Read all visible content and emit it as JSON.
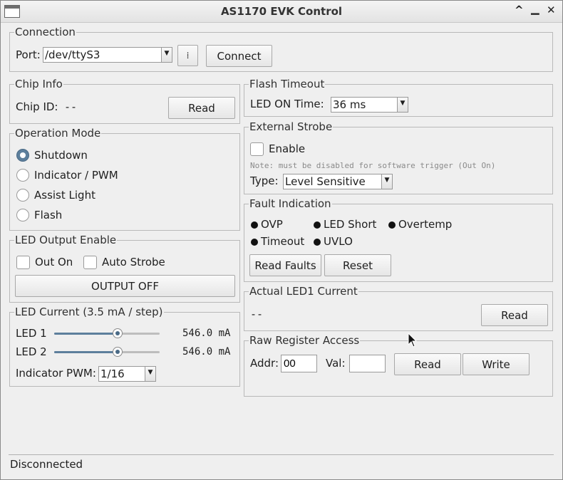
{
  "window": {
    "title": "AS1170 EVK Control"
  },
  "titlebar": {
    "minimize": "▁",
    "maximize": "^",
    "close": "✕"
  },
  "connection": {
    "legend": "Connection",
    "port_label": "Port:",
    "port_value": "/dev/ttyS3",
    "connect_label": "Connect"
  },
  "chip_info": {
    "legend": "Chip Info",
    "chip_id_label": "Chip ID:",
    "chip_id_value": "--",
    "read_label": "Read"
  },
  "operation_mode": {
    "legend": "Operation Mode",
    "options": [
      "Shutdown",
      "Indicator / PWM",
      "Assist Light",
      "Flash"
    ],
    "selected": "Shutdown"
  },
  "led_output": {
    "legend": "LED Output Enable",
    "out_on_label": "Out On",
    "auto_strobe_label": "Auto Strobe",
    "output_button": "OUTPUT OFF"
  },
  "led_current": {
    "legend": "LED Current (3.5 mA / step)",
    "led1_label": "LED 1",
    "led1_value": "546.0 mA",
    "led1_level": 0.6,
    "led2_label": "LED 2",
    "led2_value": "546.0 mA",
    "led2_level": 0.6,
    "pwm_label": "Indicator PWM:",
    "pwm_value": "1/16"
  },
  "flash_timeout": {
    "legend": "Flash Timeout",
    "led_on_label": "LED ON Time:",
    "led_on_value": "36 ms"
  },
  "external_strobe": {
    "legend": "External Strobe",
    "enable_label": "Enable",
    "note": "Note: must be disabled for software trigger (Out On)",
    "type_label": "Type:",
    "type_value": "Level Sensitive"
  },
  "fault_indication": {
    "legend": "Fault Indication",
    "faults": [
      "OVP",
      "LED Short",
      "Overtemp",
      "Timeout",
      "UVLO"
    ],
    "read_faults_label": "Read Faults",
    "reset_label": "Reset"
  },
  "actual_current": {
    "legend": "Actual LED1 Current",
    "value": "--",
    "read_label": "Read"
  },
  "raw_register": {
    "legend": "Raw Register Access",
    "addr_label": "Addr:",
    "addr_value": "00",
    "val_label": "Val:",
    "val_value": "",
    "read_label": "Read",
    "write_label": "Write"
  },
  "status": {
    "text": "Disconnected"
  }
}
